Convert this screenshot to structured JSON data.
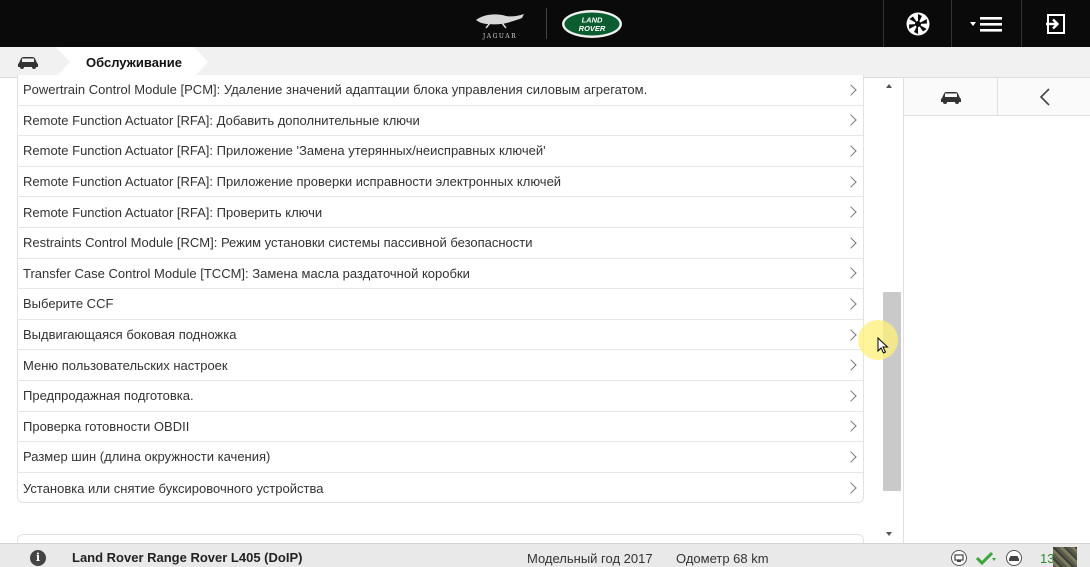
{
  "header": {
    "brand_jaguar": "JAGUAR",
    "brand_lr_line1": "LAND",
    "brand_lr_line2": "ROVER"
  },
  "breadcrumb": {
    "current": "Обслуживание"
  },
  "list": {
    "items": [
      "Powertrain Control Module [PCM]: Удаление значений адаптации блока управления силовым агрегатом.",
      "Remote Function Actuator [RFA]: Добавить дополнительные ключи",
      "Remote Function Actuator [RFA]: Приложение 'Замена утерянных/неисправных ключей'",
      "Remote Function Actuator [RFA]: Приложение проверки исправности электронных ключей",
      "Remote Function Actuator [RFA]: Проверить ключи",
      "Restraints Control Module [RCM]: Режим установки системы пассивной безопасности",
      "Transfer Case Control Module [TCCM]: Замена масла раздаточной коробки",
      "Выберите CCF",
      "Выдвигающаяся боковая подножка",
      "Меню пользовательских настроек",
      "Предпродажная подготовка.",
      "Проверка готовности OBDII",
      "Размер шин (длина окружности качения)",
      "Установка или снятие буксировочного устройства"
    ]
  },
  "footer": {
    "vehicle": "Land Rover Range Rover L405 (DoIP)",
    "model_year": "Модельный год 2017",
    "odometer": "Одометр 68 km",
    "time_partial": "13"
  },
  "colors": {
    "topbar": "#0a0a0a",
    "status_ok": "#3aa63a",
    "lr_green": "#0b5c2e"
  }
}
